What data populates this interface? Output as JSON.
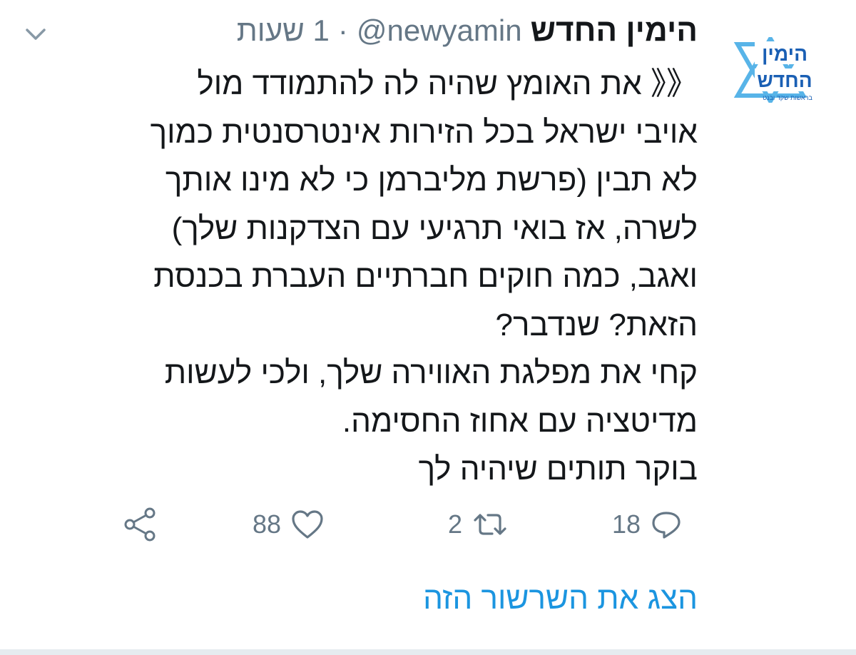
{
  "tweet": {
    "display_name": "הימין החדש",
    "handle": "@newyamin",
    "separator": "·",
    "time": "1 שעות",
    "text_lines": [
      "《《 את האומץ שהיה לה להתמודד מול",
      "אויבי ישראל בכל הזירות  אינטרסנטית כמוך",
      "לא תבין (פרשת מליברמן כי לא מינו אותך",
      "לשרה, אז בואי תרגיעי עם הצדקנות שלך)",
      "ואגב, כמה חוקים חברתיים העברת בכנסת",
      "הזאת? שנדבר?",
      "קחי את מפלגת האווירה שלך, ולכי לעשות",
      "מדיטציה עם אחוז החסימה.",
      "בוקר תותים שיהיה לך"
    ],
    "reply_count": "18",
    "retweet_count": "2",
    "like_count": "88",
    "show_thread_label": "הצג את השרשור הזה"
  },
  "logo": {
    "line1": "הימין",
    "line2": "החדש",
    "tagline": "בראשות שקד ובנט"
  },
  "icons": {
    "menu": "chevron-down-icon",
    "reply": "comment-icon",
    "retweet": "retweet-icon",
    "like": "heart-icon",
    "share": "share-icon"
  },
  "colors": {
    "text": "#14171a",
    "secondary": "#657786",
    "link": "#1b95e0",
    "logo_blue": "#1a5fb4",
    "logo_light": "#58b4e8"
  }
}
